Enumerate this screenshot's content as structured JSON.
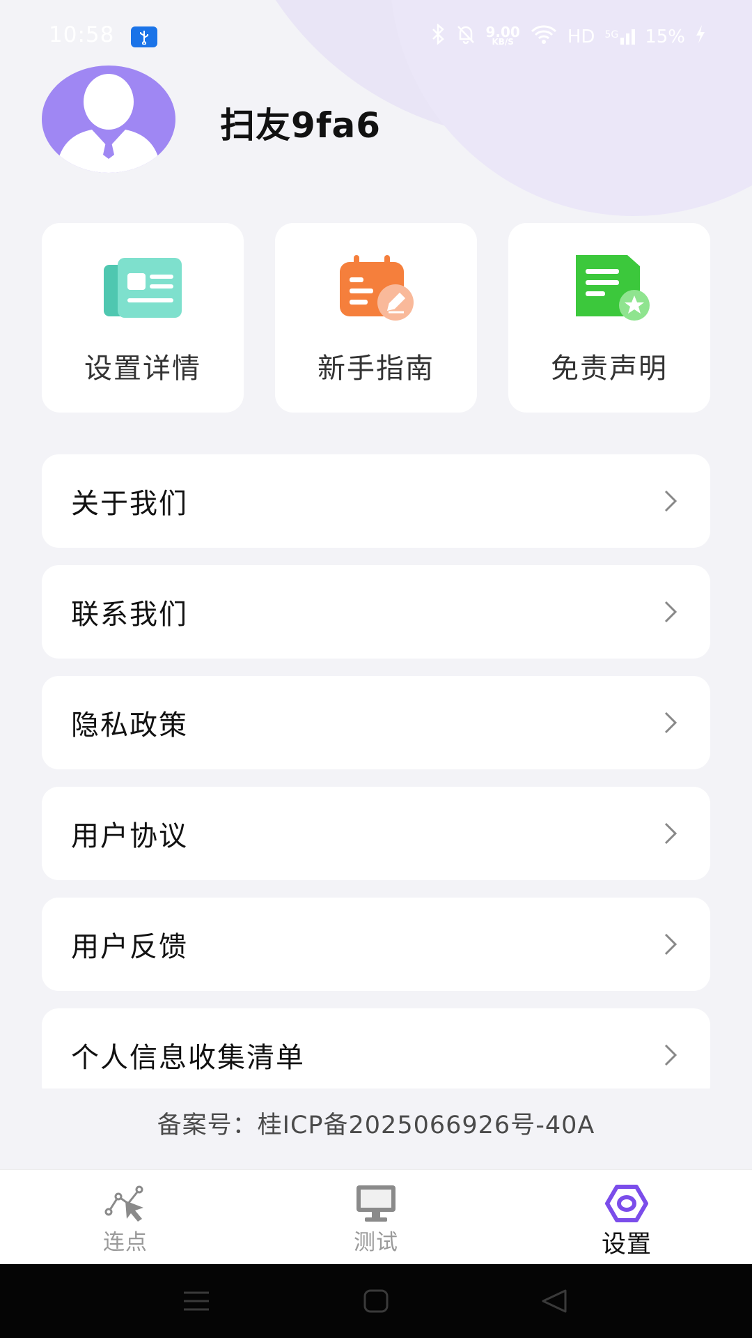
{
  "status_bar": {
    "time": "10:58",
    "usb_icon": "usb-icon",
    "net_speed_value": "9.00",
    "net_speed_unit": "KB/S",
    "network_label": "HD",
    "signal_label": "5G",
    "battery": "15%"
  },
  "profile": {
    "username": "扫友9fa6"
  },
  "quick_actions": [
    {
      "label": "设置详情",
      "icon": "id-card-icon",
      "color": "#4fc7b0"
    },
    {
      "label": "新手指南",
      "icon": "calendar-edit-icon",
      "color": "#f57f3c"
    },
    {
      "label": "免责声明",
      "icon": "document-star-icon",
      "color": "#3cc83c"
    }
  ],
  "menu": {
    "items": [
      {
        "label": "关于我们"
      },
      {
        "label": "联系我们"
      },
      {
        "label": "隐私政策"
      },
      {
        "label": "用户协议"
      },
      {
        "label": "用户反馈"
      },
      {
        "label": "个人信息收集清单"
      }
    ]
  },
  "footer": {
    "icp": "备案号：桂ICP备2025066926号-40A"
  },
  "tabs": [
    {
      "label": "连点",
      "icon": "cursor-click-icon",
      "active": false
    },
    {
      "label": "测试",
      "icon": "monitor-icon",
      "active": false
    },
    {
      "label": "设置",
      "icon": "hexagon-settings-icon",
      "active": true
    }
  ],
  "colors": {
    "accent": "#7b4dea",
    "background": "#f3f3f7",
    "avatar_bg": "#9f87f3"
  }
}
